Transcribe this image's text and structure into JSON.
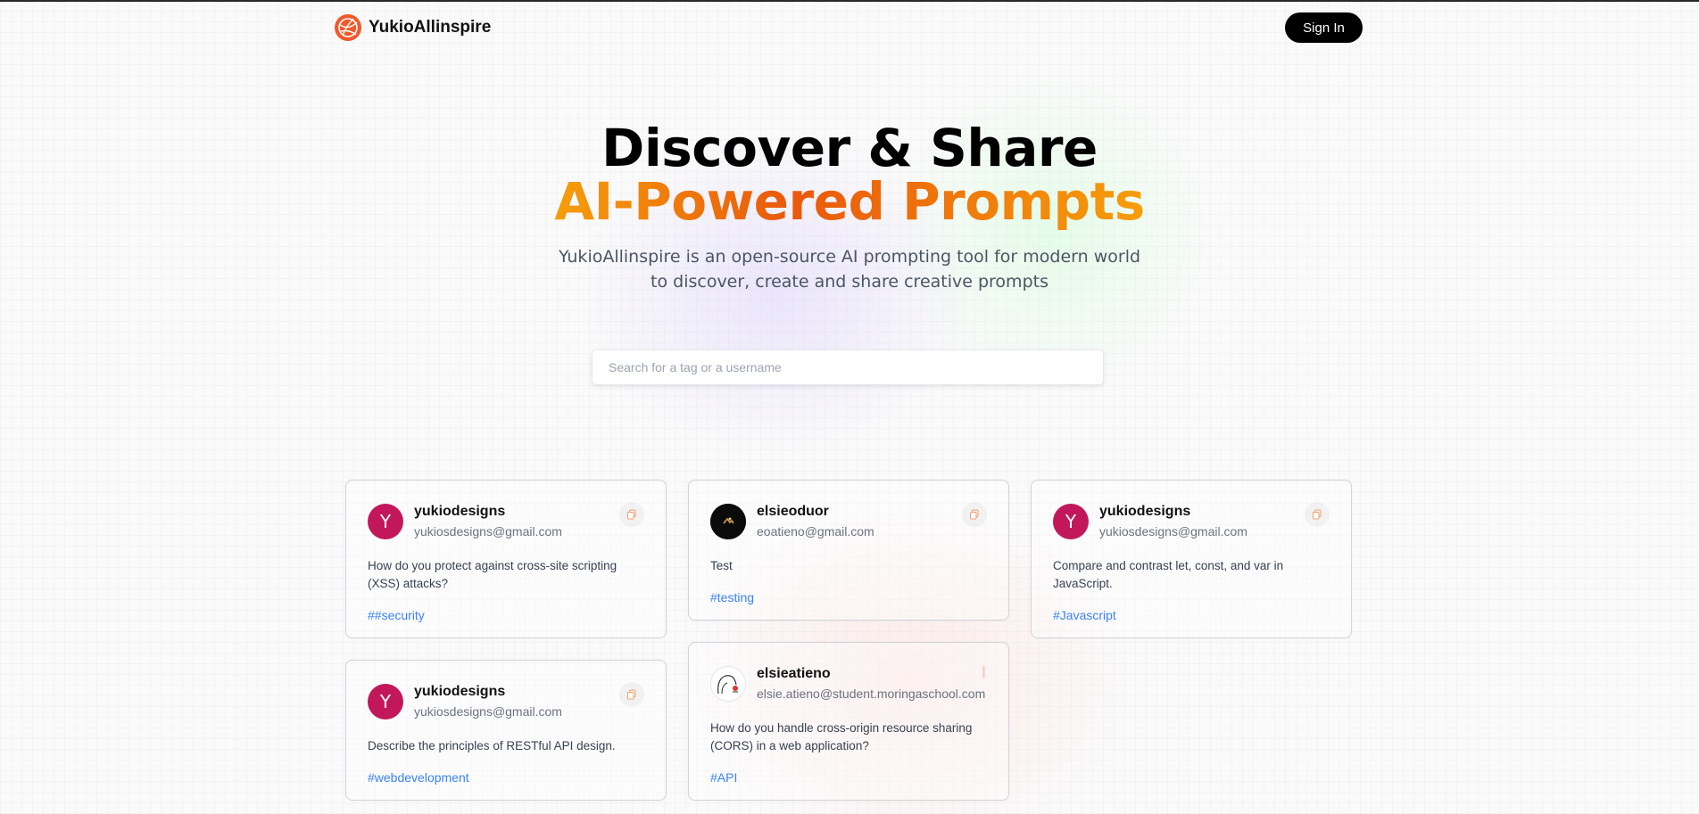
{
  "nav": {
    "brand": "YukioAllinspire",
    "sign_in": "Sign In"
  },
  "hero": {
    "line1": "Discover & Share",
    "line2": "AI-Powered Prompts",
    "subtitle": "YukioAllinspire is an open-source AI prompting tool for modern world to discover, create and share creative prompts"
  },
  "search": {
    "placeholder": "Search for a tag or a username",
    "value": ""
  },
  "colors": {
    "accent_start": "#f59e0b",
    "accent_mid": "#ea580c",
    "avatar_magenta": "#c2185b",
    "tag_blue": "#3b82f6"
  },
  "prompts": [
    {
      "username": "yukiodesigns",
      "email": "yukiosdesigns@gmail.com",
      "avatar_letter": "Y",
      "text": "How do you protect against cross-site scripting (XSS) attacks?",
      "tag": "##security",
      "icon": "copy-icon"
    },
    {
      "username": "elsieoduor",
      "email": "eoatieno@gmail.com",
      "avatar_letter": "",
      "text": "Test",
      "tag": "#testing",
      "icon": "copy-icon"
    },
    {
      "username": "yukiodesigns",
      "email": "yukiosdesigns@gmail.com",
      "avatar_letter": "Y",
      "text": "Compare and contrast let, const, and var in JavaScript.",
      "tag": "#Javascript",
      "icon": "copy-icon"
    },
    {
      "username": "yukiodesigns",
      "email": "yukiosdesigns@gmail.com",
      "avatar_letter": "Y",
      "text": "Describe the principles of RESTful API design.",
      "tag": "#webdevelopment",
      "icon": "copy-icon"
    },
    {
      "username": "elsieatieno",
      "email": "elsie.atieno@student.moringaschool.com",
      "avatar_letter": "",
      "text": "How do you handle cross-origin resource sharing (CORS) in a web application?",
      "tag": "#API",
      "icon": "copy-icon"
    }
  ]
}
